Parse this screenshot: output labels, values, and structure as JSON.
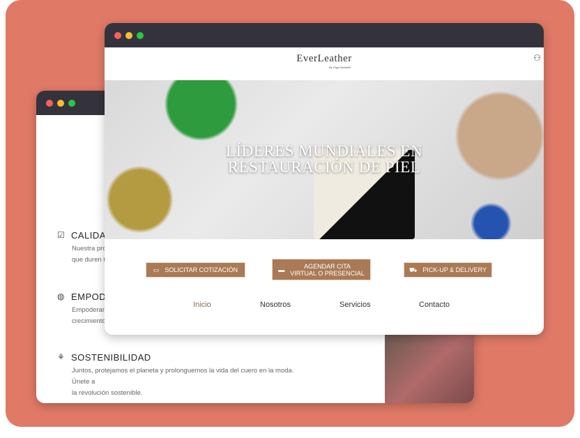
{
  "colors": {
    "background": "#e07a66",
    "titlebar": "#34333d",
    "accent": "#a97a55",
    "dot_red": "#fe5f57",
    "dot_yellow": "#febc2e",
    "dot_green": "#28c840"
  },
  "back_window": {
    "features": [
      {
        "icon": "checkbox-icon",
        "title": "CALIDAD",
        "text": "Nuestra pro",
        "text2": "que duren t"
      },
      {
        "icon": "globe-icon",
        "title": "EMPODI",
        "text": "Empoderam",
        "text2": "crecimiento"
      },
      {
        "icon": "plant-icon",
        "title": "SOSTENIBILIDAD",
        "text": "Juntos, protejamos el planeta y prolonguemos la vida del cuero en la moda. Únete a",
        "text2": "la revolución sostenible."
      }
    ]
  },
  "front_window": {
    "logo": "EverLeather",
    "byline": "By Olga Hardwell",
    "user_icon": "user-icon",
    "hero": {
      "line1": "LÍDERES MUNDIALES EN",
      "line2": "RESTAURACIÓN DE PIEL"
    },
    "buttons": [
      {
        "icon": "money-icon",
        "label": "SOLICITAR COTIZACIÓN"
      },
      {
        "icon": "store-icon",
        "label1": "AGENDAR CITA",
        "label2": "VIRTUAL O PRESENCIAL"
      },
      {
        "icon": "truck-icon",
        "label": "PICK-UP & DELIVERY"
      }
    ],
    "nav": [
      "Inicio",
      "Nosotros",
      "Servicios",
      "Contacto"
    ]
  }
}
